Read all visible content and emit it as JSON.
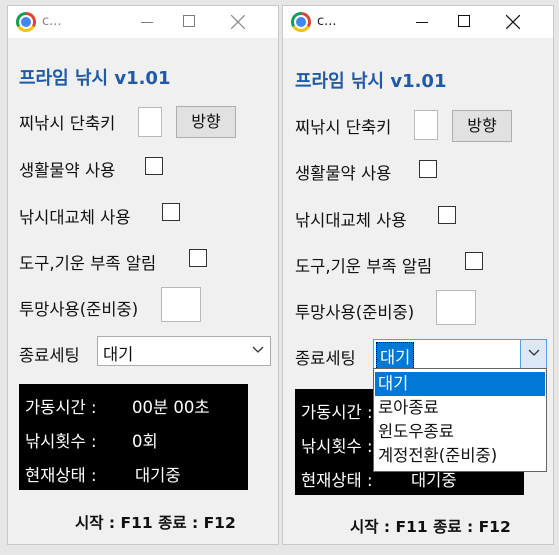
{
  "window": {
    "title": "c...",
    "title_icon": "chrome-icon"
  },
  "app": {
    "heading": "프라임 낚시 v1.01",
    "hook_shortcut_label": "찌낚시 단축키",
    "direction_button": "방향",
    "use_life_potion_label": "생활물약 사용",
    "use_fishing_replace_label": "낚시대교체 사용",
    "tool_energy_alert_label": "도구,기운 부족 알림",
    "use_throw_net_label": "투망사용(준비중)",
    "end_setting_label": "종료세팅",
    "end_setting_value": "대기",
    "end_setting_options": [
      "대기",
      "로아종료",
      "윈도우종료",
      "계정전환(준비중)"
    ],
    "status": {
      "run_time_label": "가동시간 :",
      "run_time_value": "00분 00초",
      "fish_count_label": "낚시횟수 :",
      "fish_count_value": "0회",
      "state_label": "현재상태 :",
      "state_value": "대기중"
    },
    "footer": "시작 : F11 종료 : F12"
  },
  "colors": {
    "heading": "#1f5aa8",
    "selection": "#0078d7",
    "panel_bg": "#000000"
  }
}
